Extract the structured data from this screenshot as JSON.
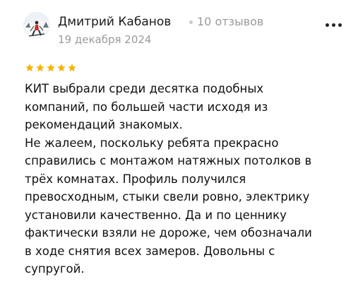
{
  "review": {
    "author_name": "Дмитрий Кабанов",
    "review_count": "10 отзывов",
    "date": "19 декабря 2024",
    "rating": 5,
    "rating_max": 5,
    "text": "КИТ выбрали среди десятка подобных\nкомпаний, по большей части исходя из\nрекомендаций знакомых.\nНе жалеем, поскольку ребята прекрасно\nсправились с монтажом натяжных потолков в\nтрёх комнатах. Профиль получился\nпревосходным, стыки свели ровно, электрику\nустановили качественно. Да и по ценнику\nфактически взяли не дороже, чем обозначали\nв ходе снятия всех замеров. Довольны с\nсупругой."
  },
  "icons": {
    "avatar": "avatar-photo",
    "menu": "more-dots-icon",
    "star": "star-icon"
  },
  "colors": {
    "star": "#f5b400",
    "text": "#111111",
    "muted": "#9a9a9a"
  }
}
